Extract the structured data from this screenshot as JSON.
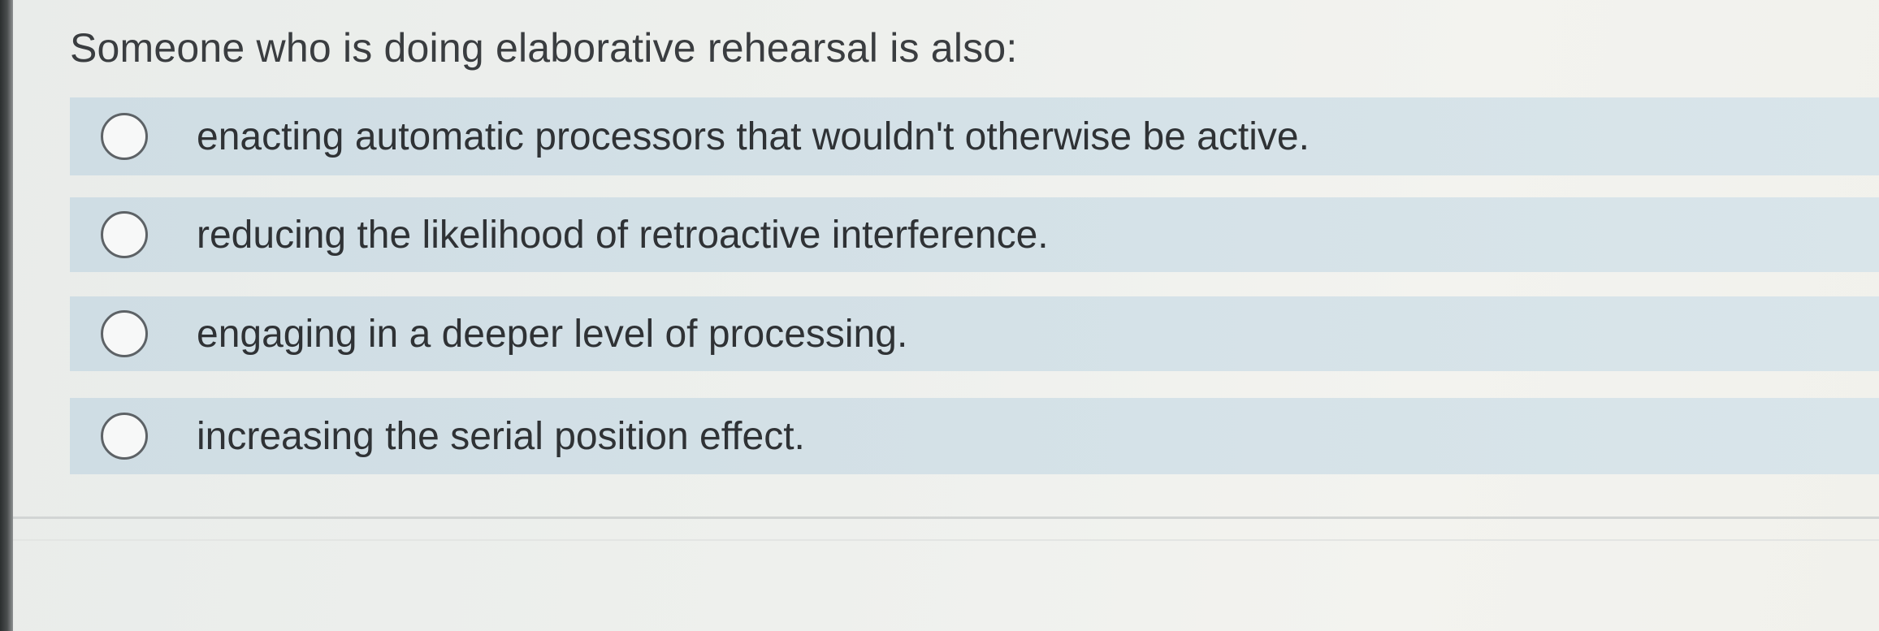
{
  "question": {
    "text": "Someone who is doing elaborative rehearsal is also:"
  },
  "options": [
    {
      "label": "enacting automatic processors that wouldn't otherwise be active.",
      "selected": false
    },
    {
      "label": "reducing the likelihood of retroactive interference.",
      "selected": false
    },
    {
      "label": "engaging in a deeper level of processing.",
      "selected": false
    },
    {
      "label": "increasing the serial position effect.",
      "selected": false
    }
  ],
  "colors": {
    "option_background": "#d4e1e7",
    "text": "#2f3235",
    "radio_border": "#5d6266"
  }
}
